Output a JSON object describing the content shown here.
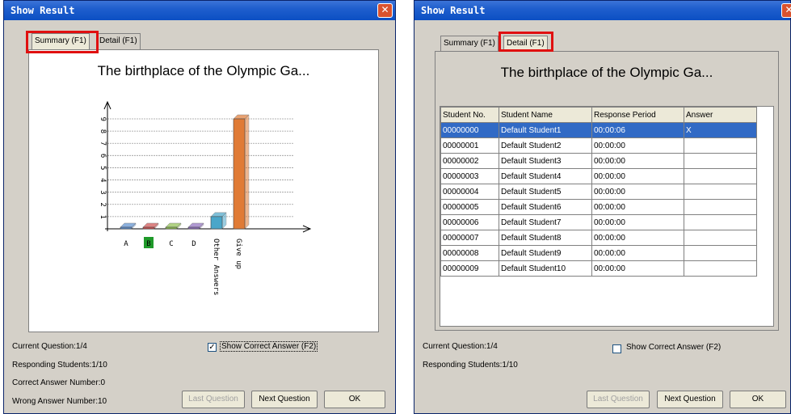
{
  "left_window": {
    "title": "Show Result",
    "tabs": [
      "Summary (F1)",
      "Detail (F1)"
    ],
    "chart_title": "The birthplace of the Olympic Ga...",
    "status": {
      "current_question": "Current Question:1/4",
      "responding": "Responding Students:1/10",
      "correct": "Correct Answer Number:0",
      "wrong": "Wrong Answer Number:10"
    },
    "show_correct": "Show Correct Answer (F2)",
    "show_correct_checked": "✓",
    "buttons": {
      "last": "Last Question",
      "next": "Next Question",
      "ok": "OK"
    }
  },
  "right_window": {
    "title": "Show Result",
    "tabs": [
      "Summary (F1)",
      "Detail (F1)"
    ],
    "chart_title": "The birthplace of the Olympic Ga...",
    "columns": [
      "Student No.",
      "Student Name",
      "Response Period",
      "Answer"
    ],
    "rows": [
      [
        "00000000",
        "Default Student1",
        "00:00:06",
        "X"
      ],
      [
        "00000001",
        "Default Student2",
        "00:00:00",
        ""
      ],
      [
        "00000002",
        "Default Student3",
        "00:00:00",
        ""
      ],
      [
        "00000003",
        "Default Student4",
        "00:00:00",
        ""
      ],
      [
        "00000004",
        "Default Student5",
        "00:00:00",
        ""
      ],
      [
        "00000005",
        "Default Student6",
        "00:00:00",
        ""
      ],
      [
        "00000006",
        "Default Student7",
        "00:00:00",
        ""
      ],
      [
        "00000007",
        "Default Student8",
        "00:00:00",
        ""
      ],
      [
        "00000008",
        "Default Student9",
        "00:00:00",
        ""
      ],
      [
        "00000009",
        "Default Student10",
        "00:00:00",
        ""
      ]
    ],
    "status": {
      "current_question": "Current Question:1/4",
      "responding": "Responding Students:1/10"
    },
    "show_correct": "Show Correct Answer (F2)",
    "buttons": {
      "last": "Last Question",
      "next": "Next Question",
      "ok": "OK"
    }
  },
  "chart_data": {
    "type": "bar",
    "title": "The birthplace of the Olympic Ga...",
    "categories": [
      "A",
      "B",
      "C",
      "D",
      "Other Answers",
      "Give up"
    ],
    "values": [
      0,
      0,
      0,
      0,
      1,
      9
    ],
    "yticks": [
      "1",
      "2",
      "3",
      "4",
      "5",
      "6",
      "7",
      "8",
      "9"
    ],
    "ylim": [
      0,
      9
    ],
    "highlighted_category": "B",
    "colors": [
      "#5b8fd1",
      "#d05050",
      "#8fbf4f",
      "#8f6fbf",
      "#4aa6c9",
      "#e07b36"
    ]
  }
}
